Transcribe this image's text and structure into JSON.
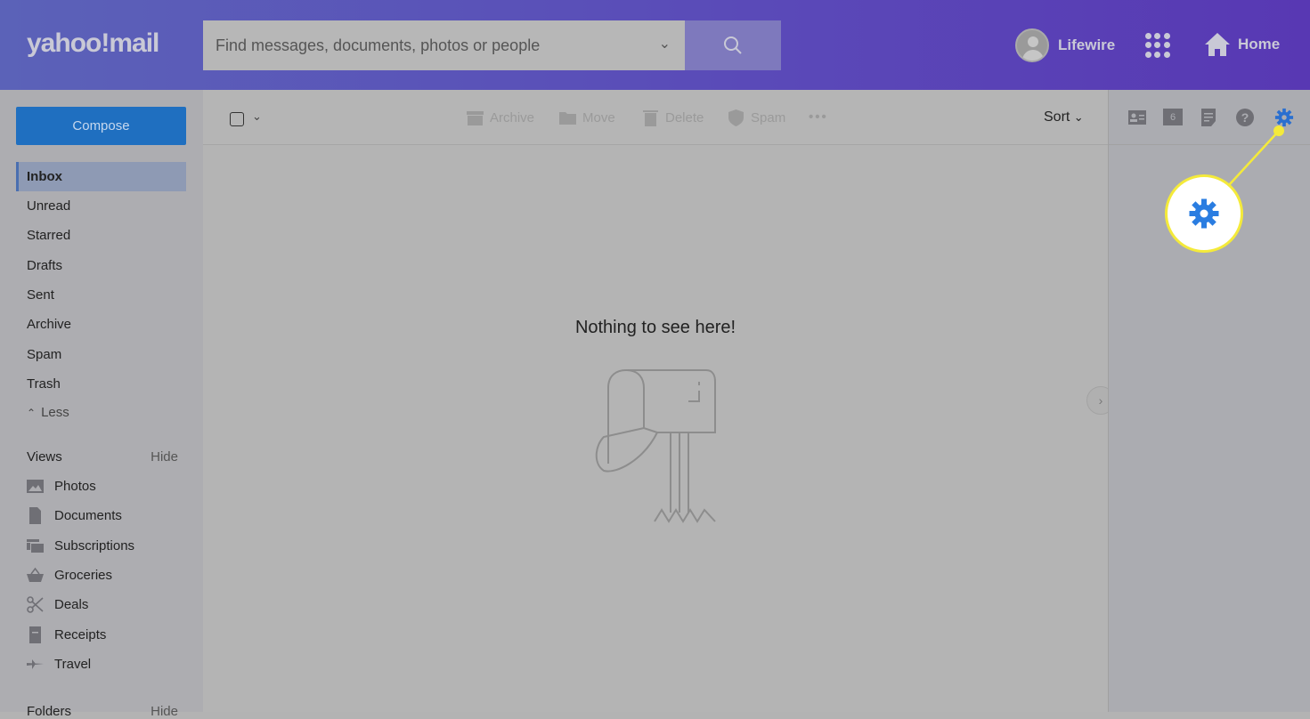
{
  "header": {
    "logo": "yahoo!mail",
    "search_placeholder": "Find messages, documents, photos or people",
    "user_name": "Lifewire",
    "home_label": "Home"
  },
  "sidebar": {
    "compose": "Compose",
    "folders": [
      {
        "label": "Inbox",
        "active": true
      },
      {
        "label": "Unread"
      },
      {
        "label": "Starred"
      },
      {
        "label": "Drafts"
      },
      {
        "label": "Sent"
      },
      {
        "label": "Archive"
      },
      {
        "label": "Spam"
      },
      {
        "label": "Trash"
      }
    ],
    "less": "Less",
    "views_title": "Views",
    "views_hide": "Hide",
    "views": [
      {
        "label": "Photos",
        "icon": "photo-icon"
      },
      {
        "label": "Documents",
        "icon": "document-icon"
      },
      {
        "label": "Subscriptions",
        "icon": "subscriptions-icon"
      },
      {
        "label": "Groceries",
        "icon": "basket-icon"
      },
      {
        "label": "Deals",
        "icon": "scissors-icon"
      },
      {
        "label": "Receipts",
        "icon": "receipt-icon"
      },
      {
        "label": "Travel",
        "icon": "plane-icon"
      }
    ],
    "folders_title": "Folders",
    "folders_hide": "Hide"
  },
  "toolbar": {
    "archive": "Archive",
    "move": "Move",
    "delete": "Delete",
    "spam": "Spam",
    "sort": "Sort"
  },
  "main": {
    "empty_message": "Nothing to see here!"
  },
  "right_panel": {
    "calendar_day": "6",
    "icons": [
      "contacts-icon",
      "calendar-icon",
      "notepad-icon",
      "help-icon",
      "settings-gear-icon"
    ]
  },
  "colors": {
    "accent": "#1f6fc0",
    "gear": "#2a7de1",
    "highlight": "#f4ea3a"
  }
}
